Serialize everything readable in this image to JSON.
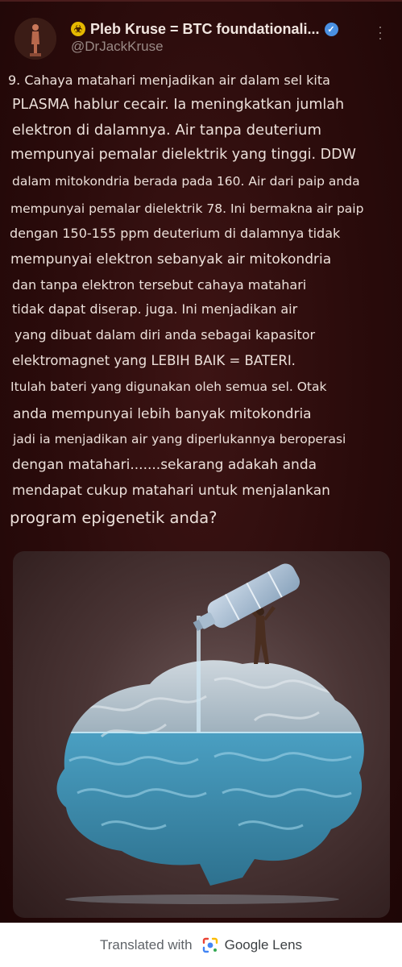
{
  "header": {
    "display_name": "Pleb Kruse = BTC foundationali...",
    "handle": "@DrJackKruse",
    "name_symbol": "☣",
    "verified_icon": "verified-badge-icon",
    "more_icon": "more-vertical-icon"
  },
  "tweet": {
    "lines": [
      "9. Cahaya matahari menjadikan air dalam sel kita",
      "PLASMA hablur cecair. Ia meningkatkan jumlah",
      "elektron di dalamnya. Air tanpa deuterium",
      "mempunyai pemalar dielektrik yang tinggi. DDW",
      "dalam mitokondria berada pada 160. Air dari paip anda",
      "mempunyai pemalar dielektrik 78. Ini bermakna air paip",
      "dengan 150-155 ppm deuterium di dalamnya tidak",
      "mempunyai elektron sebanyak air mitokondria",
      "dan tanpa elektron tersebut cahaya matahari",
      "tidak dapat diserap. juga. Ini menjadikan air",
      "yang dibuat dalam diri anda sebagai kapasitor",
      "elektromagnet yang LEBIH BAIK = BATERI.",
      "Itulah bateri yang digunakan oleh semua sel. Otak",
      "anda mempunyai lebih banyak mitokondria",
      "jadi ia menjadikan air yang diperlukannya beroperasi",
      "dengan matahari.......sekarang adakah anda",
      "mendapat cukup matahari untuk menjalankan",
      "program epigenetik anda?"
    ]
  },
  "media": {
    "description_icon": "brain-water-bottle-illustration"
  },
  "footer": {
    "label": "Translated with",
    "brand": "Google Lens",
    "icon": "google-lens-icon"
  },
  "colors": {
    "background": "#2a0a0a",
    "text": "#ece0da",
    "handle": "#9a8a86",
    "verified": "#4a90e2",
    "brain_water": "#3f8fb0"
  }
}
